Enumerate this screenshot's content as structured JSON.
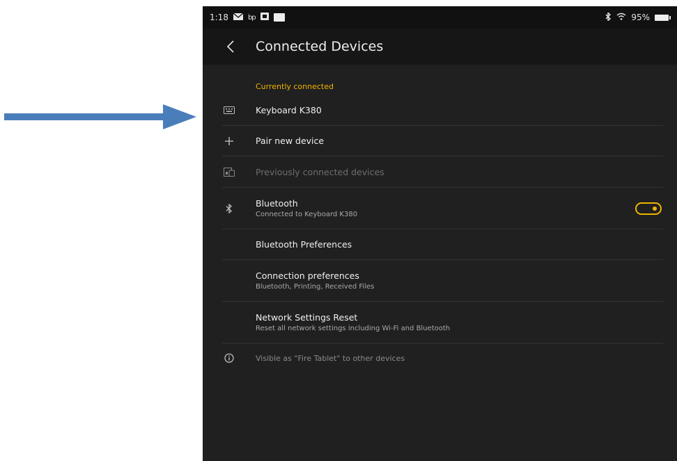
{
  "status_bar": {
    "time": "1:18",
    "app_badge": "bp",
    "battery_percent": "95%",
    "icons": [
      "mail-icon",
      "bp-badge-icon",
      "photo-icon",
      "notification-box-icon",
      "bluetooth-icon",
      "wifi-icon",
      "battery-icon"
    ]
  },
  "app_bar": {
    "title": "Connected Devices",
    "back_icon": "back-chevron-icon"
  },
  "currently_connected": {
    "header": "Currently connected",
    "device": {
      "label": "Keyboard K380",
      "icon": "keyboard-icon"
    }
  },
  "pair_new": {
    "label": "Pair new device",
    "icon": "plus-icon"
  },
  "previously_connected": {
    "label": "Previously connected devices",
    "icon": "devices-icon"
  },
  "bluetooth": {
    "label": "Bluetooth",
    "subtitle": "Connected to Keyboard K380",
    "enabled": true,
    "icon": "bluetooth-icon"
  },
  "bluetooth_preferences": {
    "label": "Bluetooth Preferences"
  },
  "connection_preferences": {
    "label": "Connection preferences",
    "subtitle": "Bluetooth, Printing, Received Files"
  },
  "network_reset": {
    "label": "Network Settings Reset",
    "subtitle": "Reset all network settings including Wi-Fi and Bluetooth"
  },
  "visibility_note": {
    "text": "Visible as \"Fire Tablet\" to other devices",
    "icon": "info-icon"
  },
  "colors": {
    "accent": "#f0b400",
    "background": "#202020",
    "annotation_arrow": "#4a7ebb"
  }
}
